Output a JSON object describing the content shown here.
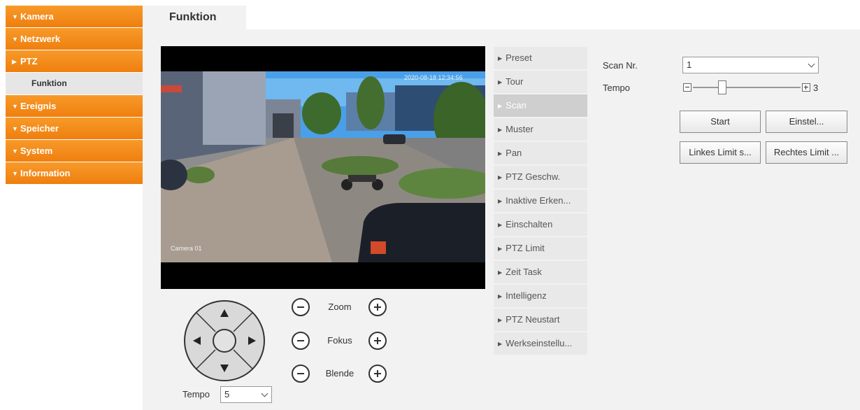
{
  "sidebar": {
    "items": [
      {
        "label": "Kamera",
        "expanded": true
      },
      {
        "label": "Netzwerk",
        "expanded": true
      },
      {
        "label": "PTZ",
        "expanded": false
      },
      {
        "label": "Funktion"
      },
      {
        "label": "Ereignis",
        "expanded": true
      },
      {
        "label": "Speicher",
        "expanded": true
      },
      {
        "label": "System",
        "expanded": true
      },
      {
        "label": "Information",
        "expanded": true
      }
    ]
  },
  "tab": {
    "label": "Funktion"
  },
  "video": {
    "osd_time": "2020-08-18 12:34:56",
    "osd_camera": "Camera 01"
  },
  "ptz": {
    "zoom_label": "Zoom",
    "focus_label": "Fokus",
    "iris_label": "Blende",
    "speed_label": "Tempo",
    "speed_value": "5"
  },
  "function_menu": {
    "items": [
      "Preset",
      "Tour",
      "Scan",
      "Muster",
      "Pan",
      "PTZ Geschw.",
      "Inaktive Erken...",
      "Einschalten",
      "PTZ Limit",
      "Zeit Task",
      "Intelligenz",
      "PTZ Neustart",
      "Werkseinstellu..."
    ],
    "active": "Scan"
  },
  "scan": {
    "scan_nr_label": "Scan Nr.",
    "scan_nr_value": "1",
    "tempo_label": "Tempo",
    "tempo_value": "3",
    "tempo_level_fraction": 0.25,
    "start_label": "Start",
    "settings_label": "Einstel...",
    "left_limit_label": "Linkes Limit s...",
    "right_limit_label": "Rechtes Limit ..."
  },
  "colors": {
    "accent": "#f08a1c",
    "panel": "#f2f2f2",
    "menu_active": "#cfcfcf"
  }
}
